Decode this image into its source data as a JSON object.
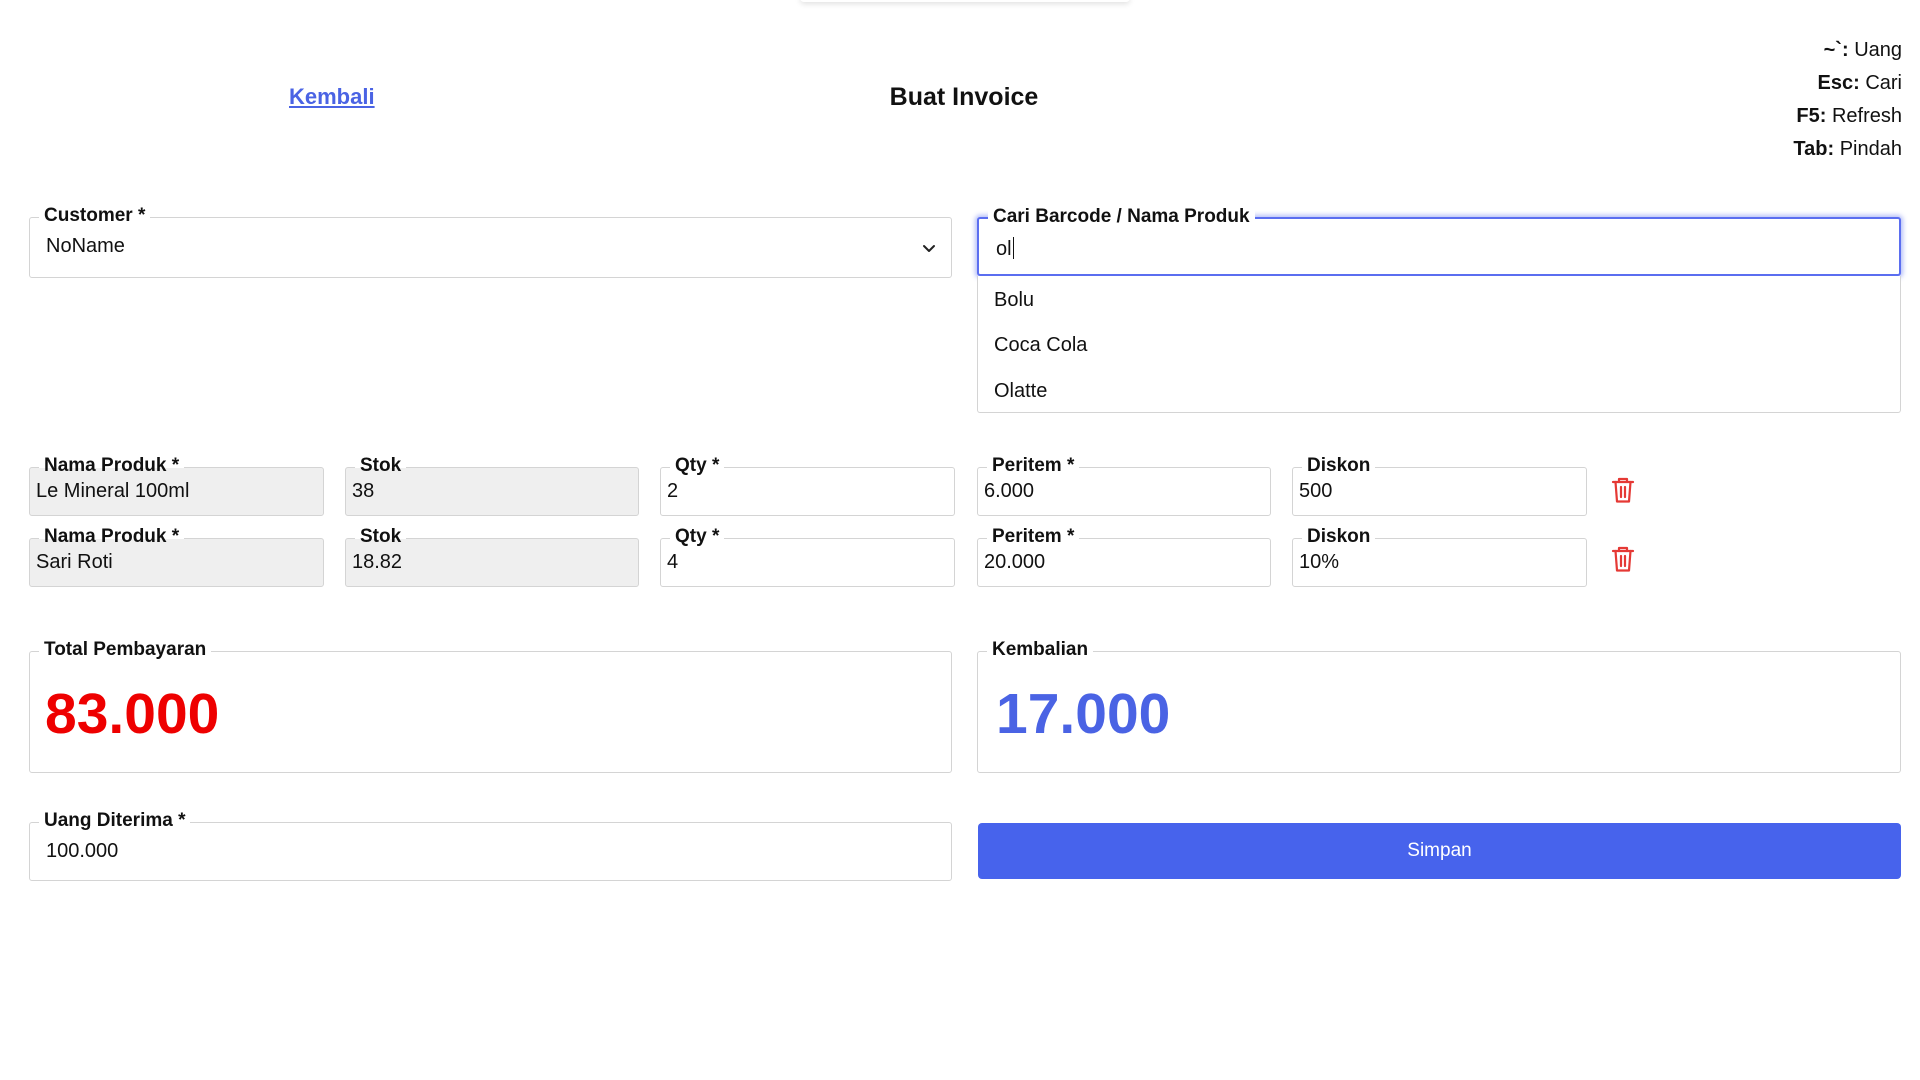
{
  "header": {
    "back_label": "Kembali",
    "title": "Buat Invoice"
  },
  "shortcuts": [
    {
      "key": "~`:",
      "label": "Uang"
    },
    {
      "key": "Esc:",
      "label": "Cari"
    },
    {
      "key": "F5:",
      "label": "Refresh"
    },
    {
      "key": "Tab:",
      "label": "Pindah"
    }
  ],
  "customer": {
    "label": "Customer *",
    "value": "NoName"
  },
  "search": {
    "label": "Cari Barcode / Nama Produk",
    "value": "ol",
    "options": [
      "Bolu",
      "Coca Cola",
      "Olatte"
    ]
  },
  "items": [
    {
      "name_label": "Nama Produk *",
      "name": "Le Mineral 100ml",
      "stock_label": "Stok",
      "stock": "38",
      "qty_label": "Qty *",
      "qty": "2",
      "price_label": "Peritem *",
      "price": "6.000",
      "discount_label": "Diskon",
      "discount": "500"
    },
    {
      "name_label": "Nama Produk *",
      "name": "Sari Roti",
      "stock_label": "Stok",
      "stock": "18.82",
      "qty_label": "Qty *",
      "qty": "4",
      "price_label": "Peritem *",
      "price": "20.000",
      "discount_label": "Diskon",
      "discount": "10%"
    }
  ],
  "total": {
    "label": "Total Pembayaran",
    "value": "83.000"
  },
  "change": {
    "label": "Kembalian",
    "value": "17.000"
  },
  "money_received": {
    "label": "Uang Diterima *",
    "value": "100.000"
  },
  "save_label": "Simpan",
  "colors": {
    "accent": "#4763ec",
    "total": "#ee0000",
    "change": "#4a63e4",
    "delete_icon": "#e53935"
  }
}
